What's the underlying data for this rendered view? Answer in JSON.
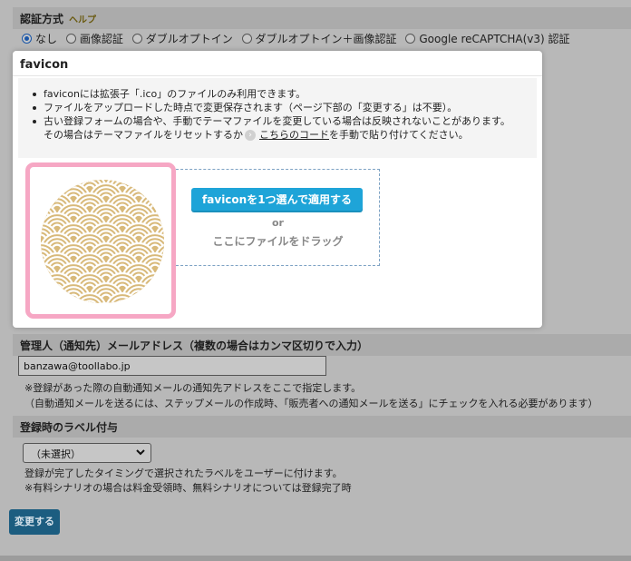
{
  "auth": {
    "title": "認証方式",
    "help": "ヘルプ",
    "options": [
      "なし",
      "画像認証",
      "ダブルオプトイン",
      "ダブルオプトイン＋画像認証",
      "Google reCAPTCHA(v3) 認証"
    ],
    "selected": "なし"
  },
  "modal": {
    "title": "favicon",
    "info": [
      "faviconには拡張子「.ico」のファイルのみ利用できます。",
      "ファイルをアップロードした時点で変更保存されます（ページ下部の「変更する」は不要）。",
      "古い登録フォームの場合や、手動でテーマファイルを変更している場合は反映されないことがあります。"
    ],
    "info_cont_before": "その場合はテーマファイルをリセットするか",
    "info_link": "こちらのコード",
    "info_cont_after": "を手動で貼り付けてください。",
    "choose_button": "faviconを1つ選んで適用する",
    "or": "or",
    "drag_text": "ここにファイルをドラッグ",
    "preview_colors": {
      "fill": "#d8b97a",
      "waves": "#ffffff",
      "frame": "#f6a7c4"
    }
  },
  "email": {
    "title": "管理人（通知先）メールアドレス（複数の場合はカンマ区切りで入力）",
    "value": "banzawa@toollabo.jp",
    "note1": "※登録があった際の自動通知メールの通知先アドレスをここで指定します。",
    "note2": "（自動通知メールを送るには、ステップメールの作成時、「販売者への通知メールを送る」にチェックを入れる必要があります）"
  },
  "label": {
    "title": "登録時のラベル付与",
    "selected": "（未選択）",
    "note1": "登録が完了したタイミングで選択されたラベルをユーザーに付けます。",
    "note2": "※有料シナリオの場合は料金受領時、無料シナリオについては登録完了時"
  },
  "submit_label": "変更する"
}
